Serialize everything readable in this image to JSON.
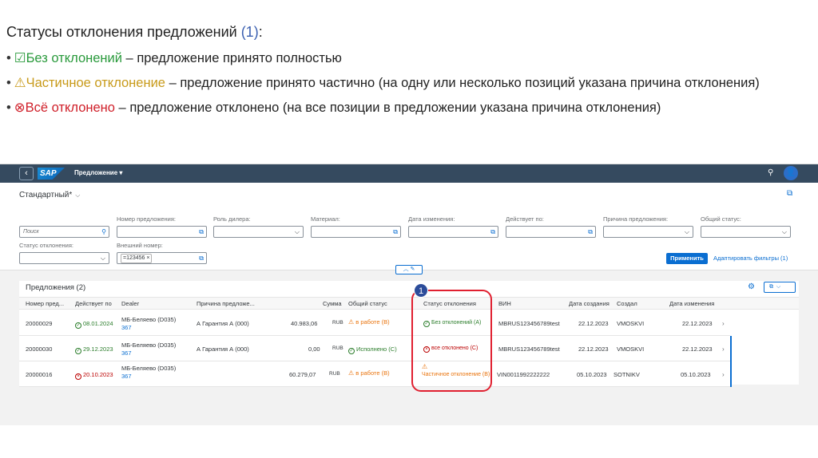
{
  "intro": {
    "title_text": "Статусы отклонения предложений ",
    "title_num": "(1)",
    "title_colon": ":",
    "bullets": [
      {
        "icon": "☑",
        "term": "Без отклонений",
        "desc": " – предложение принято полностью"
      },
      {
        "icon": "⚠",
        "term": "Частичное отклонение",
        "desc": " – предложение принято частично (на одну или несколько позиций указана причина отклонения)"
      },
      {
        "icon": "⊗",
        "term": "Всё отклонено",
        "desc": " – предложение отклонено (на все позиции в предложении указана причина отклонения)"
      }
    ]
  },
  "shell": {
    "logo": "SAP",
    "title": "Предложение ▾",
    "avatar": "👤"
  },
  "filters": {
    "variant": "Стандартный*",
    "search_placeholder": "Поиск",
    "labels": {
      "offer_number": "Номер предложения:",
      "dealer_role": "Роль дилера:",
      "material": "Материал:",
      "change_date": "Дата изменения:",
      "valid_to": "Действует по:",
      "offer_reason": "Причина предложения:",
      "general_status": "Общий статус:",
      "deviation_status": "Статус отклонения:",
      "external_number": "Внешний номер:"
    },
    "external_token": "=123456 ×",
    "apply": "Применить",
    "adapt": "Адаптировать фильтры (1)"
  },
  "table": {
    "title": "Предложения (2)",
    "columns": [
      "Номер пред...",
      "Действует по",
      "Dealer",
      "Причина предложе...",
      "Сумма",
      "Общий статус",
      "Статус отклонения",
      "ВИН",
      "Дата создания",
      "Создал",
      "Дата изменения"
    ],
    "rows": [
      {
        "number": "20000029",
        "valid": "08.01.2024",
        "dealer": "МБ-Беляево (D035)",
        "dealer_id": "367",
        "reason": "А Гарантия А (000)",
        "sum": "40.983,06",
        "currency": "RUB",
        "gen_status": "в работе (В)",
        "dev_status": "Без отклонений (А)",
        "vin": "MBRUS123456789test",
        "created": "22.12.2023",
        "creator": "VMOSKVI",
        "changed": "22.12.2023"
      },
      {
        "number": "20000030",
        "valid": "29.12.2023",
        "dealer": "МБ-Беляево (D035)",
        "dealer_id": "367",
        "reason": "А Гарантия А (000)",
        "sum": "0,00",
        "currency": "RUB",
        "gen_status": "Исполнено (С)",
        "dev_status": "все отклонено (С)",
        "vin": "MBRUS123456789test",
        "created": "22.12.2023",
        "creator": "VMOSKVI",
        "changed": "22.12.2023"
      },
      {
        "number": "20000016",
        "valid": "20.10.2023",
        "dealer": "МБ-Беляево (D035)",
        "dealer_id": "367",
        "reason": "",
        "sum": "60.279,07",
        "currency": "RUB",
        "gen_status": "в работе (В)",
        "dev_status": "Частичное отклонение (В)",
        "vin": "VIN0011992222222",
        "created": "05.10.2023",
        "creator": "SOTNIKV",
        "changed": "05.10.2023"
      }
    ]
  },
  "callout": {
    "number": "1"
  }
}
